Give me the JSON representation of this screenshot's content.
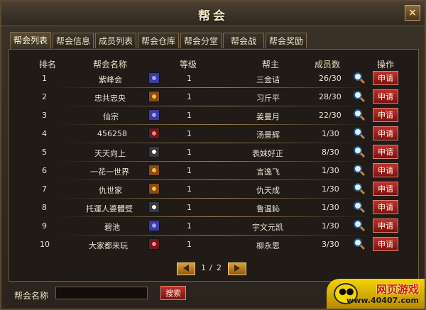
{
  "window": {
    "title": "帮会"
  },
  "tabs": [
    {
      "label": "帮会列表",
      "active": true
    },
    {
      "label": "帮会信息",
      "active": false
    },
    {
      "label": "成员列表",
      "active": false
    },
    {
      "label": "帮会仓库",
      "active": false
    },
    {
      "label": "帮会分堂",
      "active": false
    },
    {
      "label": "帮会战",
      "active": false
    },
    {
      "label": "帮会奖励",
      "active": false
    }
  ],
  "table": {
    "headers": {
      "rank": "排名",
      "name": "帮会名称",
      "level": "等级",
      "leader": "帮主",
      "members": "成员数",
      "action": "操作"
    },
    "rows": [
      {
        "rank": "1",
        "name": "紫峰会",
        "level": "1",
        "leader": "三金诘",
        "members": "26/30",
        "apply": "申请",
        "flag": "blue"
      },
      {
        "rank": "2",
        "name": "忠共忠央",
        "level": "1",
        "leader": "习斤平",
        "members": "28/30",
        "apply": "申请",
        "flag": "gold"
      },
      {
        "rank": "3",
        "name": "仙宗",
        "level": "1",
        "leader": "姜曼月",
        "members": "22/30",
        "apply": "申请",
        "flag": "blue"
      },
      {
        "rank": "4",
        "name": "456258",
        "level": "1",
        "leader": "汤景辉",
        "members": "1/30",
        "apply": "申请",
        "flag": "red"
      },
      {
        "rank": "5",
        "name": "天天向上",
        "level": "1",
        "leader": "表妹好正",
        "members": "8/30",
        "apply": "申请",
        "flag": "white"
      },
      {
        "rank": "6",
        "name": "一花一世界",
        "level": "1",
        "leader": "言逸飞",
        "members": "1/30",
        "apply": "申请",
        "flag": "gold"
      },
      {
        "rank": "7",
        "name": "仇世家",
        "level": "1",
        "leader": "仇天成",
        "members": "1/30",
        "apply": "申请",
        "flag": "gold"
      },
      {
        "rank": "8",
        "name": "托運人婆體䢃",
        "level": "1",
        "leader": "鲁温鈊",
        "members": "1/30",
        "apply": "申请",
        "flag": "white"
      },
      {
        "rank": "9",
        "name": "碧池",
        "level": "1",
        "leader": "宇文元凯",
        "members": "1/30",
        "apply": "申请",
        "flag": "blue"
      },
      {
        "rank": "10",
        "name": "大家都来玩",
        "level": "1",
        "leader": "柳永思",
        "members": "3/30",
        "apply": "申请",
        "flag": "red"
      }
    ]
  },
  "pagination": {
    "current": "1",
    "separator": "/",
    "total": "2"
  },
  "bottom": {
    "label": "帮会名称",
    "search_value": "",
    "search_placeholder": "",
    "search_button": "搜索"
  },
  "brand": {
    "line1": "网页游戏",
    "line2": "www.40407.com"
  }
}
